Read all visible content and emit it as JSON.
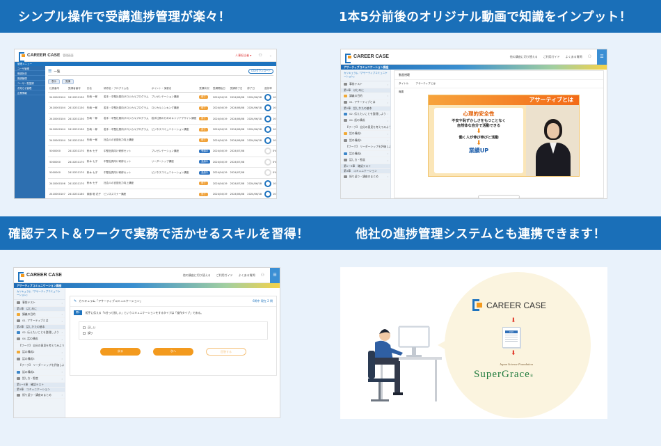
{
  "banners": {
    "top_left": "シンプル操作で受講進捗管理が楽々！",
    "top_right": "1本5分前後のオリジナル動画で知識をインプット！",
    "bottom_left": "確認テスト＆ワークで実務で活かせるスキルを習得！",
    "bottom_right": "他社の進捗管理システムとも連携できます！"
  },
  "brand": {
    "name": "CAREER CASE",
    "primary_color": "#1a6fb8",
    "accent_color": "#f39a1e"
  },
  "admin": {
    "app_title": "CAREER CASE",
    "app_sub": "管理画面",
    "user_label": "人事担当者 ▾",
    "side_header": "管理メニュー",
    "side_items": [
      "ユーザ管理",
      "受講状況",
      "受講管理",
      "ユーザ一覧登録",
      "お知らせ管理",
      "企業情報"
    ],
    "page_title": "一覧",
    "export_label": "CSVダウンロード",
    "tab_labels": [
      "表示",
      "受講"
    ],
    "columns": [
      "社員番号",
      "受講者番号",
      "氏名",
      "研修名・プログラム名",
      "ポイント・演習名",
      "受講状況",
      "受講開始日",
      "受講修了日",
      "修了日",
      "進捗率",
      "受講"
    ],
    "rows": [
      {
        "id": "2410000104",
        "no": "2410231130",
        "name": "矢嶋 一郎",
        "program": "若手・中堅社員向けロジカルプログラム",
        "course": "プレゼンテーション講座",
        "status": "修了",
        "start": "2024/04/19",
        "end": "2024/06/08",
        "done": "2024/06/18",
        "rate": "100%",
        "time": "00:01"
      },
      {
        "id": "2410000104",
        "no": "2410231130",
        "name": "矢嶋 一郎",
        "program": "若手・中堅社員向けロジカルプログラム",
        "course": "ロジカルシンキング講座",
        "status": "修了",
        "start": "2024/04/19",
        "end": "2024/06/08",
        "done": "2024/06/18",
        "rate": "100%",
        "time": "06:46"
      },
      {
        "id": "2410000104",
        "no": "2410231130",
        "name": "矢嶋 一郎",
        "program": "若手・中堅社員向けロジカルプログラム",
        "course": "若手社員のためのキャリアデザイン講座",
        "status": "修了",
        "start": "2024/04/19",
        "end": "2024/06/08",
        "done": "2024/06/18",
        "rate": "100%",
        "time": "27:27"
      },
      {
        "id": "2410000104",
        "no": "2410231130",
        "name": "矢嶋 一郎",
        "program": "若手・中堅社員向けロジカルプログラム",
        "course": "ビジネスコミュニケーション講座",
        "status": "修了",
        "start": "2024/04/19",
        "end": "2024/06/08",
        "done": "2024/06/18",
        "rate": "100%",
        "time": "06:08"
      },
      {
        "id": "2410000104",
        "no": "2410231130",
        "name": "矢嶋 一郎",
        "program": "社会人の言語化力向上講座",
        "course": "",
        "status": "修了",
        "start": "2024/04/19",
        "end": "2024/06/08",
        "done": "2024/06/18",
        "rate": "100%",
        "time": "06:50"
      },
      {
        "id": "5000000",
        "no": "2410231170",
        "name": "鈴木 七子",
        "program": "中堅社員向け研修セット",
        "course": "プレゼンテーション講座",
        "status": "受講中",
        "start": "2024/04/19",
        "end": "2024/07/08",
        "done": "",
        "rate": "0%",
        "time": "00:00"
      },
      {
        "id": "5000000",
        "no": "2410231170",
        "name": "鈴木 七子",
        "program": "中堅社員向け研修セット",
        "course": "リーダーシップ講座",
        "status": "受講中",
        "start": "2024/04/19",
        "end": "2024/07/08",
        "done": "",
        "rate": "0%",
        "time": "00:00"
      },
      {
        "id": "5000000",
        "no": "2410231170",
        "name": "鈴木 七子",
        "program": "中堅社員向け研修セット",
        "course": "ビジネスコミュニケーション講座",
        "status": "受講中",
        "start": "2024/04/19",
        "end": "2024/07/08",
        "done": "",
        "rate": "0%",
        "time": "00:00"
      },
      {
        "id": "2410000106",
        "no": "2410231170",
        "name": "鈴木 七子",
        "program": "社会人の言語化力向上講座",
        "course": "",
        "status": "修了",
        "start": "2024/04/19",
        "end": "2024/07/08",
        "done": "2024/06/18",
        "rate": "100%",
        "time": "25:12"
      },
      {
        "id": "2410000107",
        "no": "2410231180",
        "name": "斉藤 聡 花子",
        "program": "ビジネスマナー講座",
        "course": "",
        "status": "修了",
        "start": "2024/04/19",
        "end": "2024/06/08",
        "done": "2024/06/18",
        "rate": "100%",
        "time": "25:16"
      }
    ]
  },
  "learner": {
    "header_links": [
      "他の講座に切り替える",
      "ご利用ガイド",
      "よくある質問"
    ],
    "course_title": "アサーティブコミュニケーション講座",
    "curriculum_label": "カリキュラム「アサーティブコミュニケーション」",
    "side_items": [
      "事前テスト",
      "第1章　はじめに",
      "講義の目的",
      "01. アサーティブとは",
      "第2章　話しかたの基本",
      "02. 伝えたいことを整理しよう",
      "04. 話の構成",
      "【ワーク】 自分の意見を考えてみよう",
      "話の構成2",
      "話の構成3",
      "【ワーク】 リーダーシップを評価しよう",
      "話の構成4",
      "話し方・態度",
      "第1ー3章　確認テスト",
      "第3章　コミュニケーション",
      "振り返り・講座のまとめ"
    ],
    "video_panel_title": "動画視聴",
    "video_title_label": "タイトル",
    "video_title_value": "アサーティブとは",
    "summary_label": "概要",
    "slide": {
      "header": "アサーティブとは",
      "line1": "心理的安全性",
      "line2": "不安や恥ずかしさをもつことなく",
      "line3": "自然体な自分で活動できる",
      "line4": "働く人が伸び伸びと活動",
      "line5": "業績UP"
    },
    "quiz": {
      "title": "カリキュラム「アサーティブコミュニケーション」",
      "progress": "6問中 現在 2 問",
      "q_label": "問1",
      "question": "相手に伝える「5分って欲しい」というコミュニケーションをするタイプは「協作タイプ」である。",
      "options": [
        "正しい",
        "誤り"
      ],
      "buttons": [
        "戻る",
        "次へ",
        "回答する"
      ]
    }
  },
  "integration": {
    "brand": "CAREER CASE",
    "doc_label": "CSV",
    "partner_small": "Japan Science Foundation",
    "partner_name": "SuperGrace"
  }
}
